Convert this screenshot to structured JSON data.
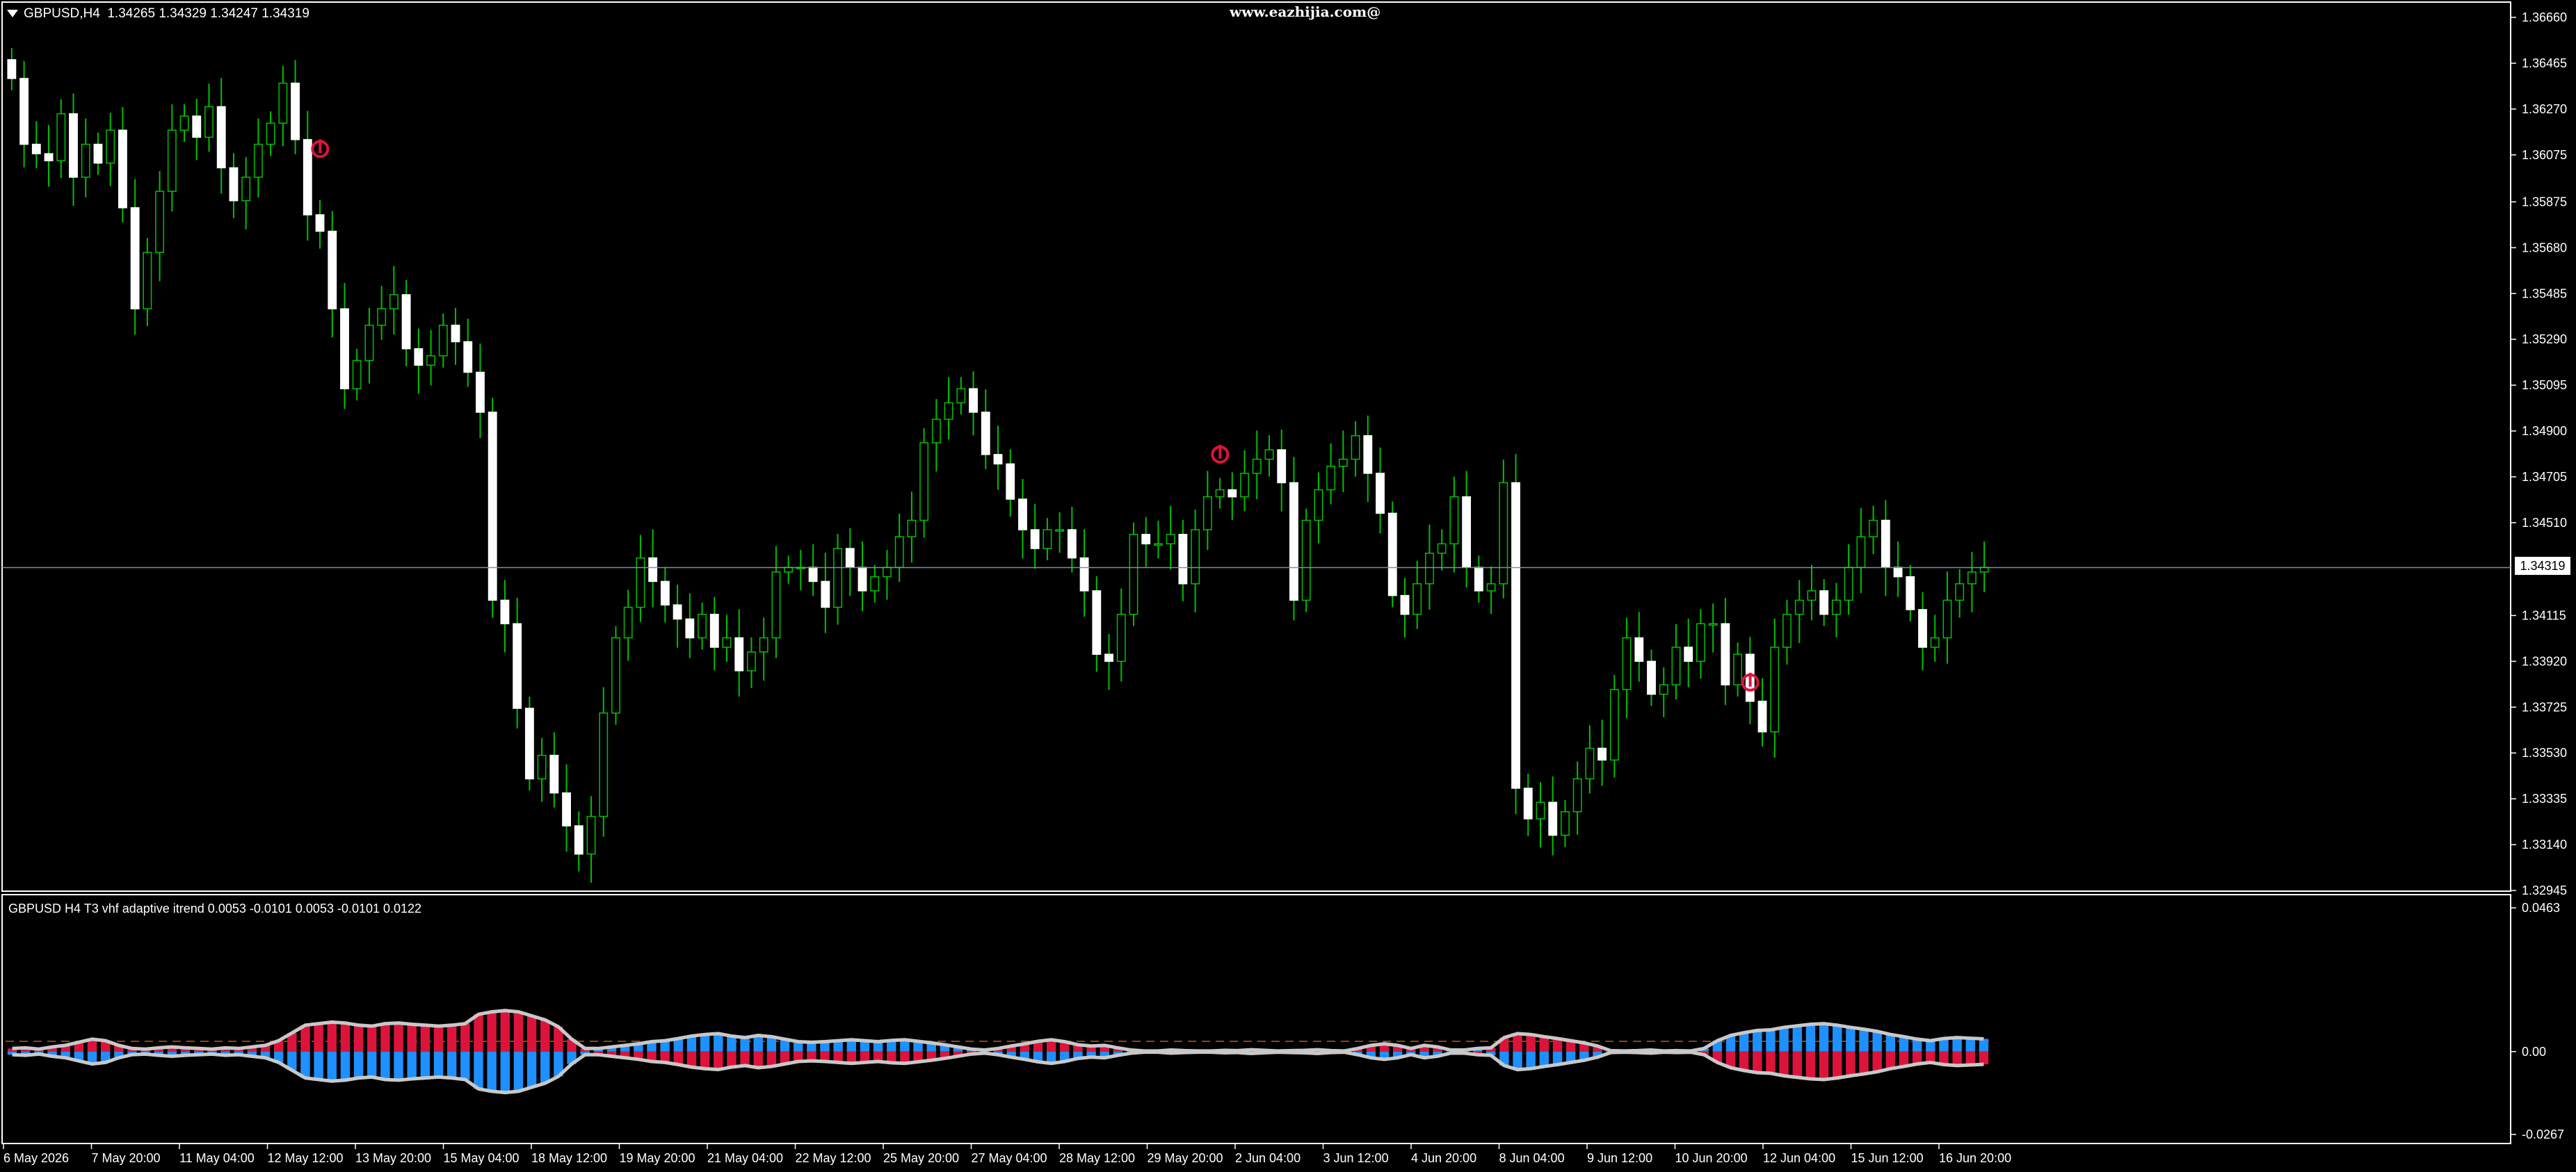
{
  "window": {
    "symbol_header": "GBPUSD,H4  1.34265 1.34329 1.34247 1.34319",
    "watermark": "www.eazhijia.com@",
    "current_price_tag": "1.34319"
  },
  "indicator": {
    "header": "GBPUSD H4 T3 vhf adaptive itrend 0.0053 -0.0101 0.0053 -0.0101 0.0122"
  },
  "colors": {
    "background": "#000000",
    "frame": "#ffffff",
    "bull_wick": "#00c000",
    "bull_body": "#ffffff",
    "bear_fill": "#ffffff",
    "price_line": "#7f8fa6",
    "hist_positive": "#dc143c",
    "hist_negative": "#1e90ff",
    "envelope": "#c8c8c8",
    "signal_level": "#8b4513",
    "arrow": "#dc143c"
  },
  "chart_data": [
    {
      "type": "candlestick",
      "title": "GBPUSD,H4",
      "ylim": [
        1.32945,
        1.3666
      ],
      "y_ticks": [
        "1.36660",
        "1.36465",
        "1.36270",
        "1.36075",
        "1.35875",
        "1.35680",
        "1.35485",
        "1.35290",
        "1.35095",
        "1.34900",
        "1.34705",
        "1.34510",
        "1.34115",
        "1.33920",
        "1.33725",
        "1.33530",
        "1.33335",
        "1.33140",
        "1.32945"
      ],
      "current_price": 1.34319,
      "x_ticks": [
        "6 May 2026",
        "7 May 20:00",
        "11 May 04:00",
        "12 May 12:00",
        "13 May 20:00",
        "15 May 04:00",
        "18 May 12:00",
        "19 May 20:00",
        "21 May 04:00",
        "22 May 12:00",
        "25 May 20:00",
        "27 May 04:00",
        "28 May 12:00",
        "29 May 20:00",
        "2 Jun 04:00",
        "3 Jun 12:00",
        "4 Jun 20:00",
        "8 Jun 04:00",
        "9 Jun 12:00",
        "10 Jun 20:00",
        "12 Jun 04:00",
        "15 Jun 12:00",
        "16 Jun 20:00"
      ],
      "close_path": [
        1.364,
        1.3612,
        1.3608,
        1.3605,
        1.3625,
        1.3598,
        1.3612,
        1.3604,
        1.3618,
        1.3585,
        1.3542,
        1.3566,
        1.3592,
        1.3618,
        1.3624,
        1.3615,
        1.3628,
        1.3602,
        1.3588,
        1.3598,
        1.3612,
        1.3621,
        1.3638,
        1.3614,
        1.3582,
        1.3575,
        1.3542,
        1.3508,
        1.352,
        1.3535,
        1.3542,
        1.3548,
        1.3525,
        1.3518,
        1.3522,
        1.3535,
        1.3528,
        1.3515,
        1.3498,
        1.3418,
        1.3408,
        1.3372,
        1.3342,
        1.3352,
        1.3336,
        1.3322,
        1.331,
        1.3326,
        1.337,
        1.3402,
        1.3415,
        1.3436,
        1.3426,
        1.3416,
        1.341,
        1.3402,
        1.3412,
        1.3398,
        1.3402,
        1.3388,
        1.3396,
        1.3402,
        1.343,
        1.3432,
        1.3432,
        1.3426,
        1.3415,
        1.344,
        1.3432,
        1.3422,
        1.3428,
        1.3432,
        1.3445,
        1.3452,
        1.3485,
        1.3495,
        1.3502,
        1.3508,
        1.3498,
        1.348,
        1.3476,
        1.3461,
        1.3448,
        1.344,
        1.3448,
        1.3448,
        1.3436,
        1.3422,
        1.3395,
        1.3392,
        1.3412,
        1.3446,
        1.3442,
        1.3442,
        1.3446,
        1.3425,
        1.3448,
        1.3462,
        1.3465,
        1.3462,
        1.3472,
        1.3478,
        1.3482,
        1.3468,
        1.3418,
        1.3452,
        1.3465,
        1.3475,
        1.3478,
        1.3488,
        1.3472,
        1.3455,
        1.342,
        1.3412,
        1.3425,
        1.3438,
        1.3442,
        1.3462,
        1.3432,
        1.3422,
        1.3425,
        1.3468,
        1.3338,
        1.3325,
        1.3332,
        1.3318,
        1.3328,
        1.3342,
        1.3355,
        1.335,
        1.338,
        1.3402,
        1.3392,
        1.3378,
        1.3382,
        1.3398,
        1.3392,
        1.3408,
        1.3408,
        1.3382,
        1.3395,
        1.3375,
        1.3362,
        1.3398,
        1.3412,
        1.3418,
        1.3422,
        1.3412,
        1.3418,
        1.3432,
        1.3445,
        1.3452,
        1.3432,
        1.3428,
        1.3414,
        1.3398,
        1.3402,
        1.3418,
        1.3425,
        1.343,
        1.3432
      ]
    },
    {
      "type": "bar",
      "title": "GBPUSD H4 T3 vhf adaptive itrend",
      "ylim": [
        -0.0267,
        0.0463
      ],
      "y_ticks": [
        "0.0463",
        "0.00",
        "-0.0267"
      ],
      "signal_level": 0.0033,
      "series": [
        {
          "name": "T3 vhf adaptive itrend",
          "values": [
            0.001,
            0.0012,
            0.0008,
            0.0015,
            0.002,
            0.003,
            0.004,
            0.0035,
            0.002,
            0.001,
            0.0008,
            0.0012,
            0.0015,
            0.0012,
            0.001,
            0.0008,
            0.0012,
            0.001,
            0.0015,
            0.002,
            0.0035,
            0.006,
            0.0085,
            0.009,
            0.0095,
            0.0092,
            0.0085,
            0.0082,
            0.009,
            0.0092,
            0.0088,
            0.0085,
            0.0082,
            0.0085,
            0.009,
            0.012,
            0.0128,
            0.0132,
            0.0128,
            0.0115,
            0.0102,
            0.008,
            0.004,
            0.001,
            -0.001,
            -0.0015,
            -0.002,
            -0.0025,
            -0.0032,
            -0.0035,
            -0.0042,
            -0.005,
            -0.0055,
            -0.0058,
            -0.005,
            -0.0045,
            -0.0052,
            -0.0048,
            -0.004,
            -0.0032,
            -0.003,
            -0.0032,
            -0.0035,
            -0.0038,
            -0.0035,
            -0.0032,
            -0.0036,
            -0.0038,
            -0.0033,
            -0.0028,
            -0.0022,
            -0.0015,
            -0.0008,
            0.0005,
            0.001,
            0.0018,
            0.0025,
            0.0033,
            0.0038,
            0.0032,
            0.0022,
            0.0018,
            0.002,
            0.0012,
            0.0005,
            -0.0002,
            0.0002,
            0.0005,
            0.0003,
            0.0002,
            -0.0002,
            0.0004,
            0.0003,
            0.0006,
            0.0004,
            0.0002,
            0.0003,
            0.0004,
            0.0006,
            0.0003,
            -0.0002,
            0.001,
            0.002,
            0.0025,
            0.002,
            0.001,
            0.002,
            0.0015,
            0.0005,
            -0.0005,
            -0.001,
            0.0012,
            0.0045,
            0.0058,
            0.0055,
            0.0048,
            0.0042,
            0.0035,
            0.0028,
            0.0018,
            0.0003,
            0.0002,
            -0.0003,
            -0.0005,
            0.0002,
            0.0003,
            -0.0002,
            -0.001,
            -0.0035,
            -0.0052,
            -0.0061,
            -0.0068,
            -0.007,
            -0.0078,
            -0.0083,
            -0.0088,
            -0.009,
            -0.0085,
            -0.0078,
            -0.0072,
            -0.0065,
            -0.0055,
            -0.0048,
            -0.004,
            -0.0035,
            -0.0042,
            -0.0045,
            -0.0043,
            -0.0041
          ]
        }
      ]
    }
  ]
}
